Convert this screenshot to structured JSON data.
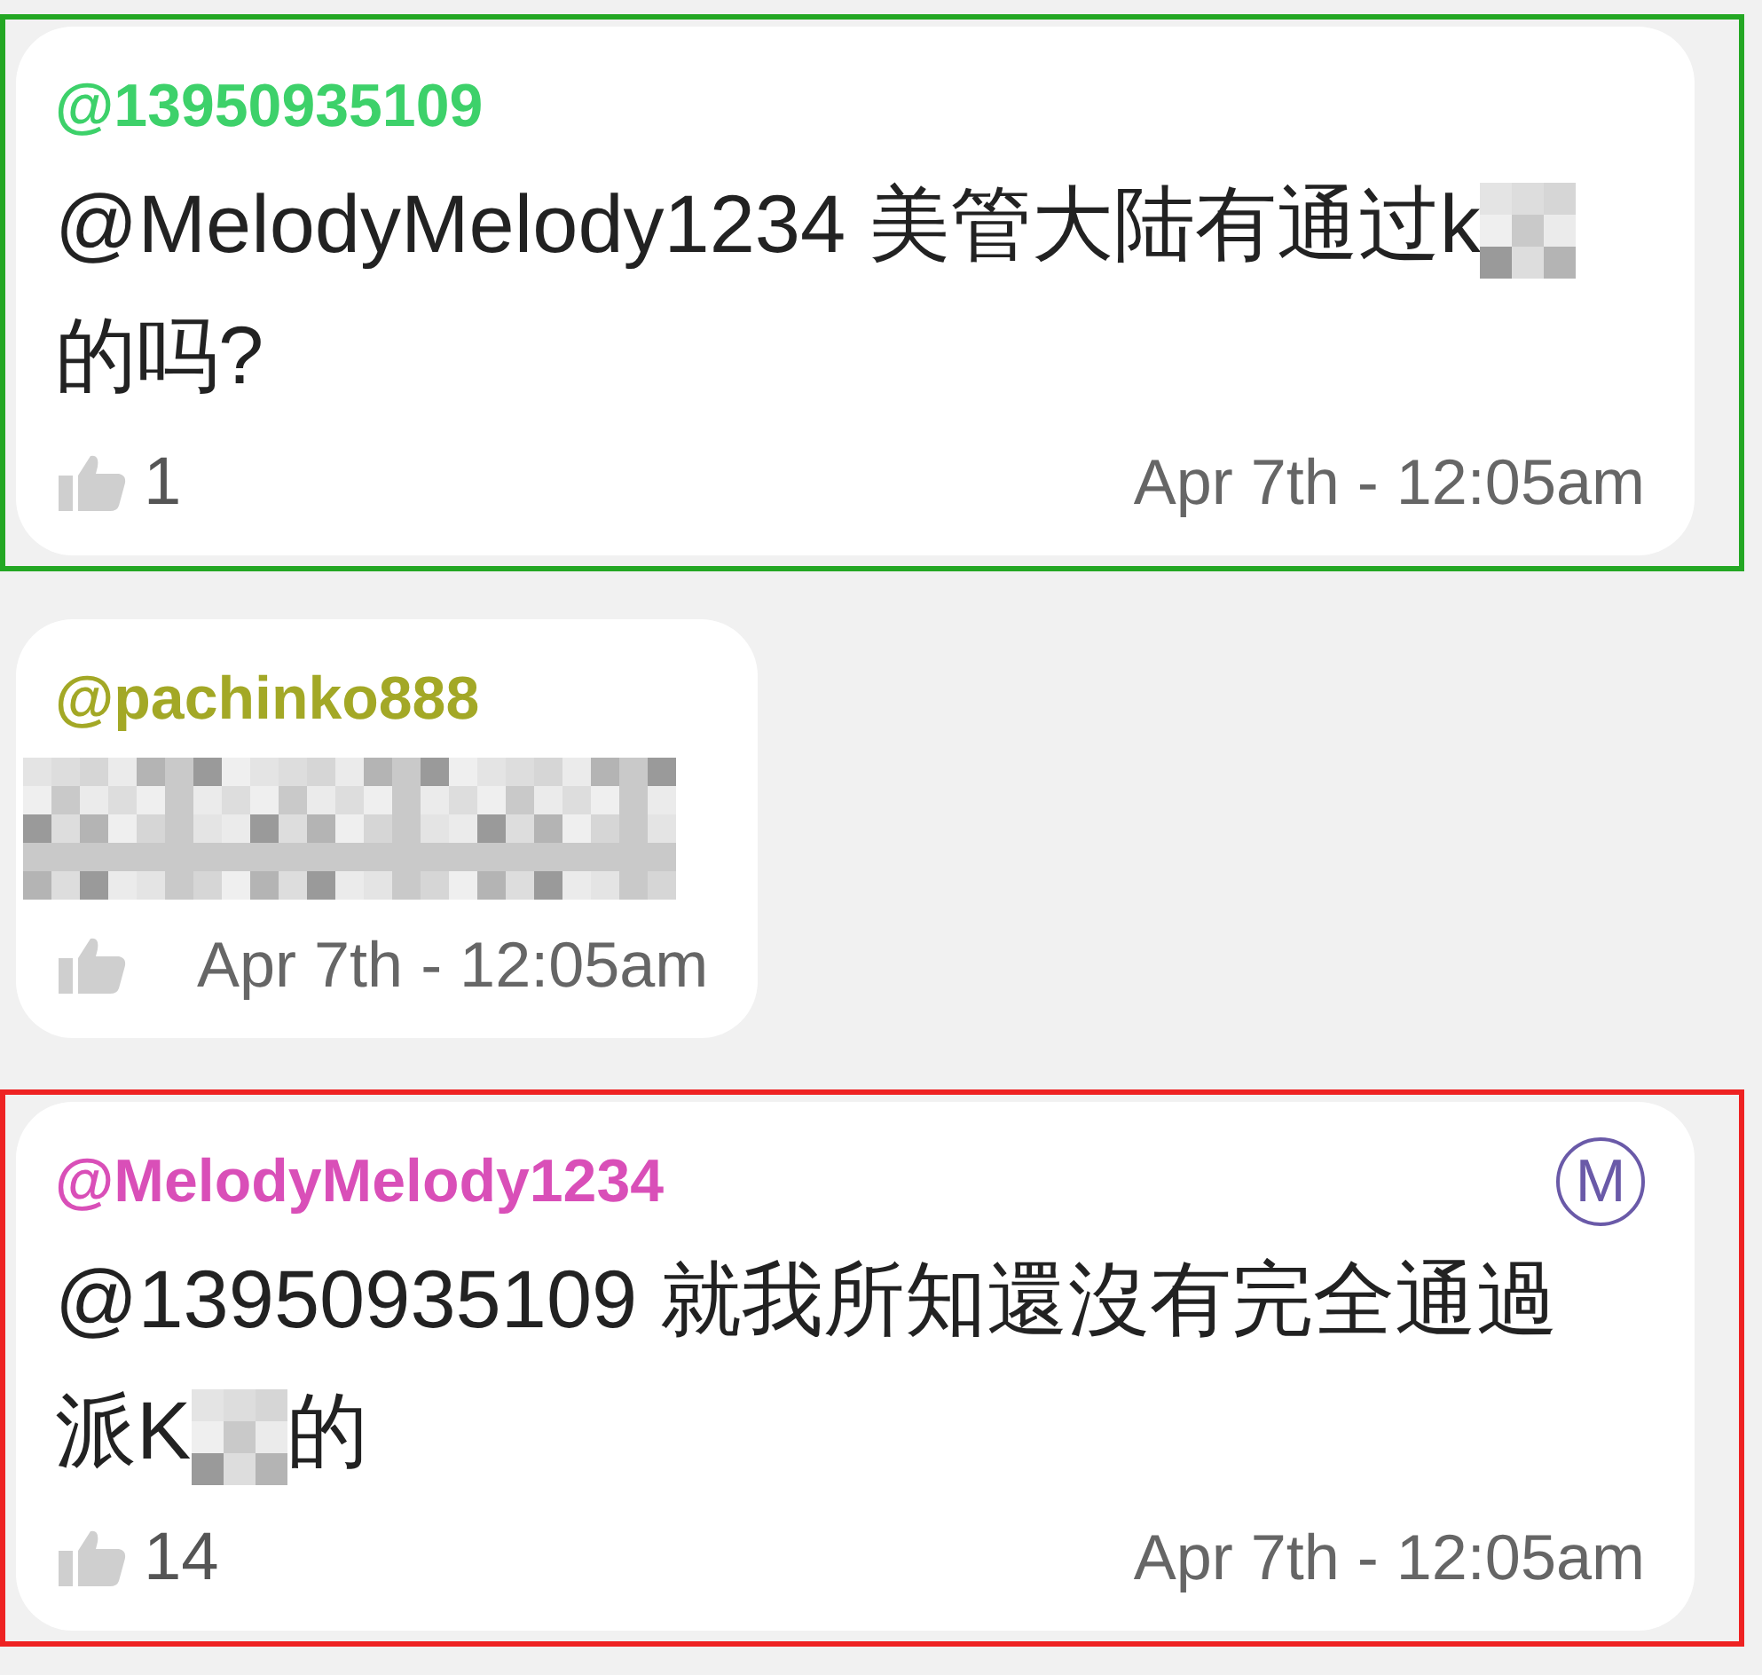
{
  "comments": [
    {
      "author": "@13950935109",
      "color": "#3dd16a",
      "frame": {
        "color": "#23a723"
      },
      "body": [
        {
          "kind": "text",
          "text": "@MelodyMelody1234 美管大陆有通过k"
        },
        {
          "kind": "redacted"
        },
        {
          "kind": "text",
          "text": "的吗?"
        }
      ],
      "likes": "1",
      "time": "Apr 7th - 12:05am"
    },
    {
      "author": "@pachinko888",
      "color": "#a3a826",
      "body": [
        {
          "kind": "redacted_block"
        }
      ],
      "time": "Apr 7th - 12:05am"
    },
    {
      "author": "@MelodyMelody1234",
      "color": "#d94fb8",
      "frame": {
        "color": "#ee2222"
      },
      "badge": "M",
      "body": [
        {
          "kind": "text",
          "text": "@13950935109 就我所知還沒有完全通過"
        },
        {
          "kind": "text",
          "text": "派K"
        },
        {
          "kind": "redacted"
        },
        {
          "kind": "text",
          "text": "的"
        }
      ],
      "likes": "14",
      "time": "Apr 7th - 12:05am"
    }
  ]
}
